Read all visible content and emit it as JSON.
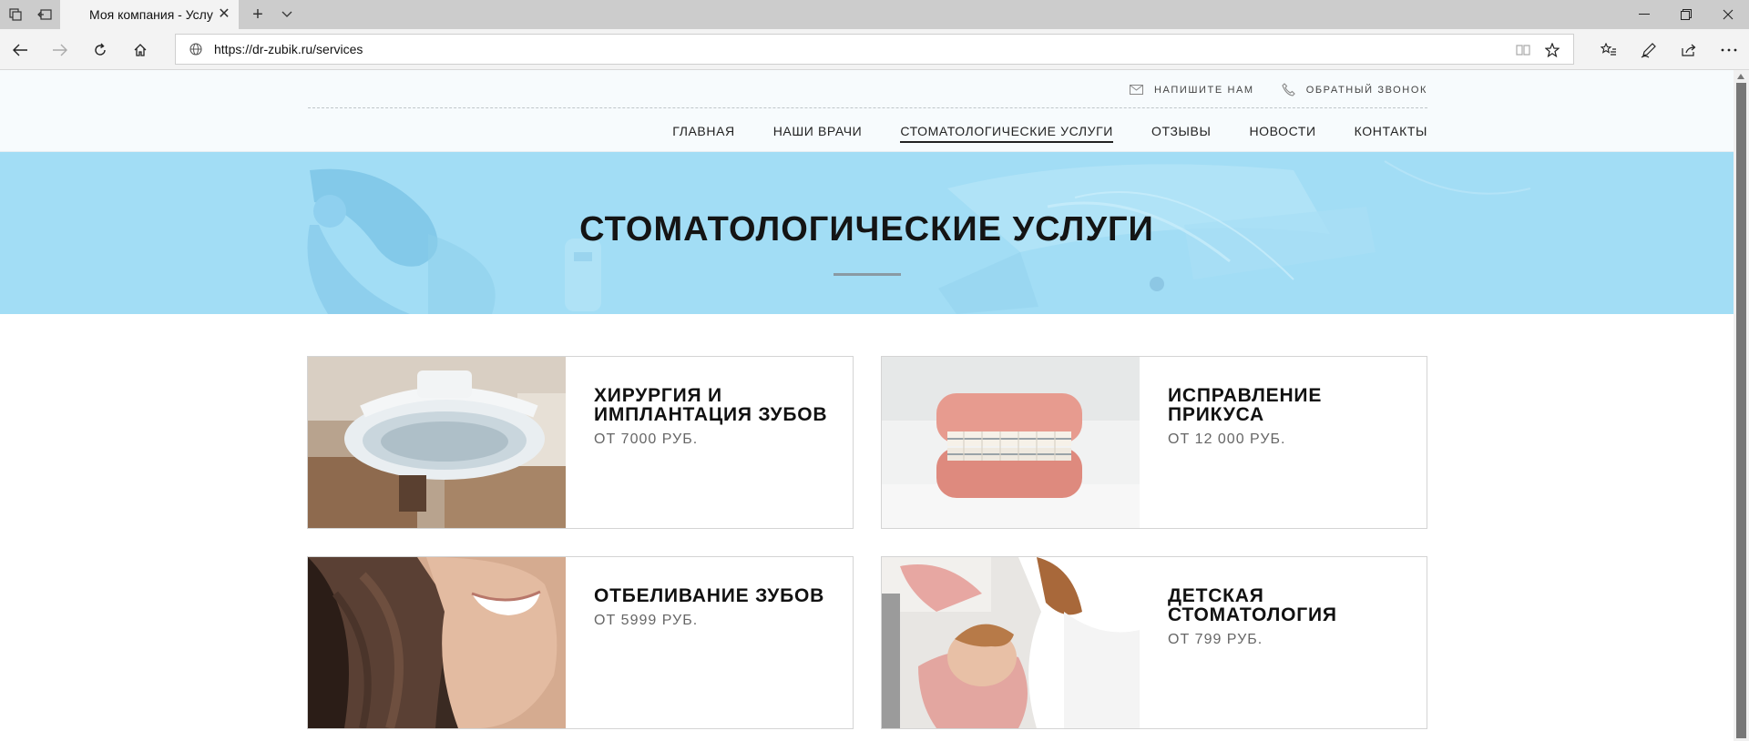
{
  "browser": {
    "tab_title": "Моя компания - Услуги",
    "url": "https://dr-zubik.ru/services"
  },
  "header": {
    "contacts": [
      {
        "label": "НАПИШИТЕ НАМ",
        "icon": "mail-icon"
      },
      {
        "label": "ОБРАТНЫЙ ЗВОНОК",
        "icon": "phone-icon"
      }
    ],
    "nav": [
      {
        "label": "ГЛАВНАЯ",
        "active": false
      },
      {
        "label": "НАШИ ВРАЧИ",
        "active": false
      },
      {
        "label": "СТОМАТОЛОГИЧЕСКИЕ УСЛУГИ",
        "active": true
      },
      {
        "label": "ОТЗЫВЫ",
        "active": false
      },
      {
        "label": "НОВОСТИ",
        "active": false
      },
      {
        "label": "КОНТАКТЫ",
        "active": false
      }
    ]
  },
  "hero": {
    "title": "СТОМАТОЛОГИЧЕСКИЕ УСЛУГИ"
  },
  "services": [
    {
      "title": "ХИРУРГИЯ И ИМПЛАНТАЦИЯ ЗУБОВ",
      "price": "ОТ 7000 РУБ."
    },
    {
      "title": "ИСПРАВЛЕНИЕ ПРИКУСА",
      "price": "ОТ 12 000 РУБ."
    },
    {
      "title": "ОТБЕЛИВАНИЕ ЗУБОВ",
      "price": "ОТ 5999 РУБ."
    },
    {
      "title": "ДЕТСКАЯ СТОМАТОЛОГИЯ",
      "price": "ОТ 799 РУБ."
    }
  ],
  "colors": {
    "hero_bg": "#a2ddf5",
    "header_bg": "#f7fbfd",
    "text_dark": "#111111",
    "price_gray": "#666666"
  }
}
